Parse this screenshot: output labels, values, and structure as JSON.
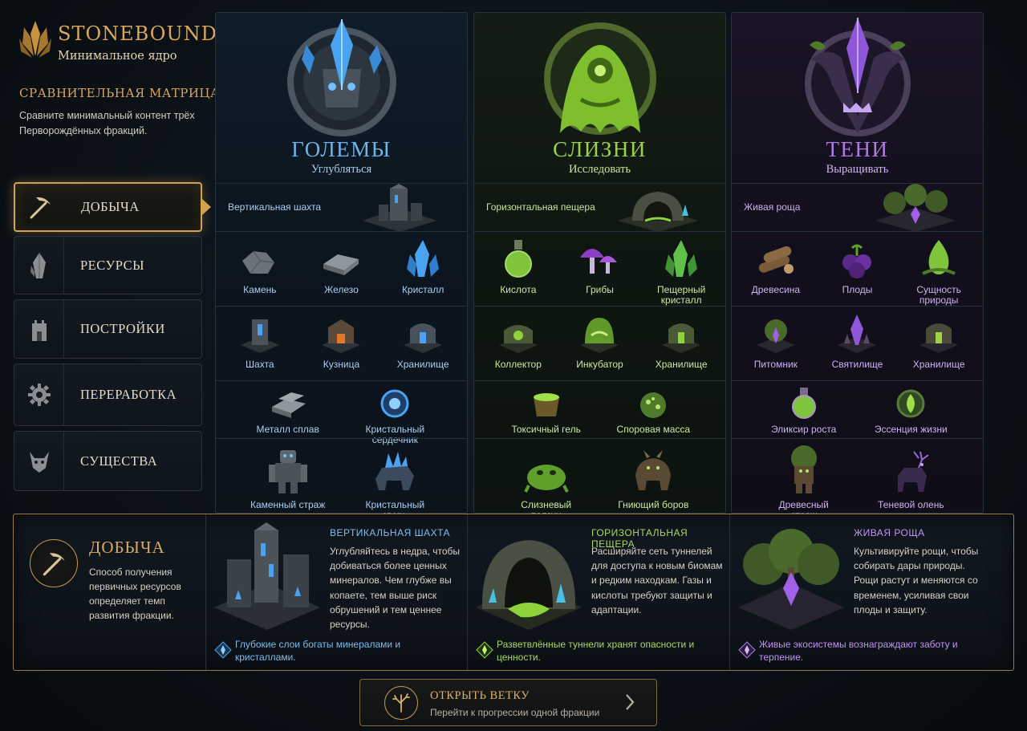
{
  "app": {
    "title": "STONEBOUND",
    "subtitle": "Минимальное ядро"
  },
  "matrix": {
    "title": "СРАВНИТЕЛЬНАЯ МАТРИЦА",
    "description": "Сравните минимальный контент трёх Перворождённых фракций."
  },
  "nav": [
    {
      "label": "ДОБЫЧА",
      "icon": "pickaxe-icon",
      "active": true
    },
    {
      "label": "РЕСУРСЫ",
      "icon": "crystal-icon",
      "active": false
    },
    {
      "label": "ПОСТРОЙКИ",
      "icon": "tower-icon",
      "active": false
    },
    {
      "label": "ПЕРЕРАБОТКА",
      "icon": "gear-icon",
      "active": false
    },
    {
      "label": "СУЩЕСТВА",
      "icon": "creature-head-icon",
      "active": false
    }
  ],
  "colors": {
    "accent": "#d3a24e",
    "golems": "#6db4e8",
    "slimes": "#9bd24a",
    "shadows": "#b07ae0"
  },
  "factions": [
    {
      "name": "ГОЛЕМЫ",
      "verb": "Углубляться",
      "mining": "Вертикальная шахта",
      "resources": [
        "Камень",
        "Железо",
        "Кристалл"
      ],
      "buildings": [
        "Шахта",
        "Кузница",
        "Хранилище"
      ],
      "processing": [
        "Металл сплав",
        "Кристальный сердечник"
      ],
      "creatures": [
        "Каменный страж",
        "Кристальный зверь"
      ]
    },
    {
      "name": "СЛИЗНИ",
      "verb": "Исследовать",
      "mining": "Горизонтальная пещера",
      "resources": [
        "Кислота",
        "Грибы",
        "Пещерный кристалл"
      ],
      "buildings": [
        "Коллектор",
        "Инкубатор",
        "Хранилище"
      ],
      "processing": [
        "Токсичный гель",
        "Споровая масса"
      ],
      "creatures": [
        "Слизневый ползун",
        "Гниющий боров"
      ]
    },
    {
      "name": "ТЕНИ",
      "verb": "Выращивать",
      "mining": "Живая роща",
      "resources": [
        "Древесина",
        "Плоды",
        "Сущность природы"
      ],
      "buildings": [
        "Питомник",
        "Святилище",
        "Хранилище"
      ],
      "processing": [
        "Эликсир роста",
        "Эссенция жизни"
      ],
      "creatures": [
        "Древесный страж",
        "Теневой олень"
      ]
    }
  ],
  "detail": {
    "title": "ДОБЫЧА",
    "description": "Способ получения первичных ресурсов определяет темп развития фракции.",
    "cards": [
      {
        "title": "ВЕРТИКАЛЬНАЯ ШАХТА",
        "body": "Углубляйтесь в недра, чтобы добиваться более ценных минералов. Чем глубже вы копаете, тем выше риск обрушений и тем ценнее ресурсы.",
        "note": "Глубокие слои богаты минералами и кристаллами."
      },
      {
        "title": "ГОРИЗОНТАЛЬНАЯ ПЕЩЕРА",
        "body": "Расширяйте сеть туннелей для доступа к новым биомам и редким находкам. Газы и кислоты требуют защиты и адаптации.",
        "note": "Разветвлённые туннели хранят опасности и ценности."
      },
      {
        "title": "ЖИВАЯ РОЩА",
        "body": "Культивируйте рощи, чтобы собирать дары природы. Рощи растут и меняются со временем, усиливая свои плоды и защиту.",
        "note": "Живые экосистемы вознаграждают заботу и терпение."
      }
    ]
  },
  "cta": {
    "title": "ОТКРЫТЬ ВЕТКУ",
    "subtitle": "Перейти к прогрессии одной фракции"
  }
}
